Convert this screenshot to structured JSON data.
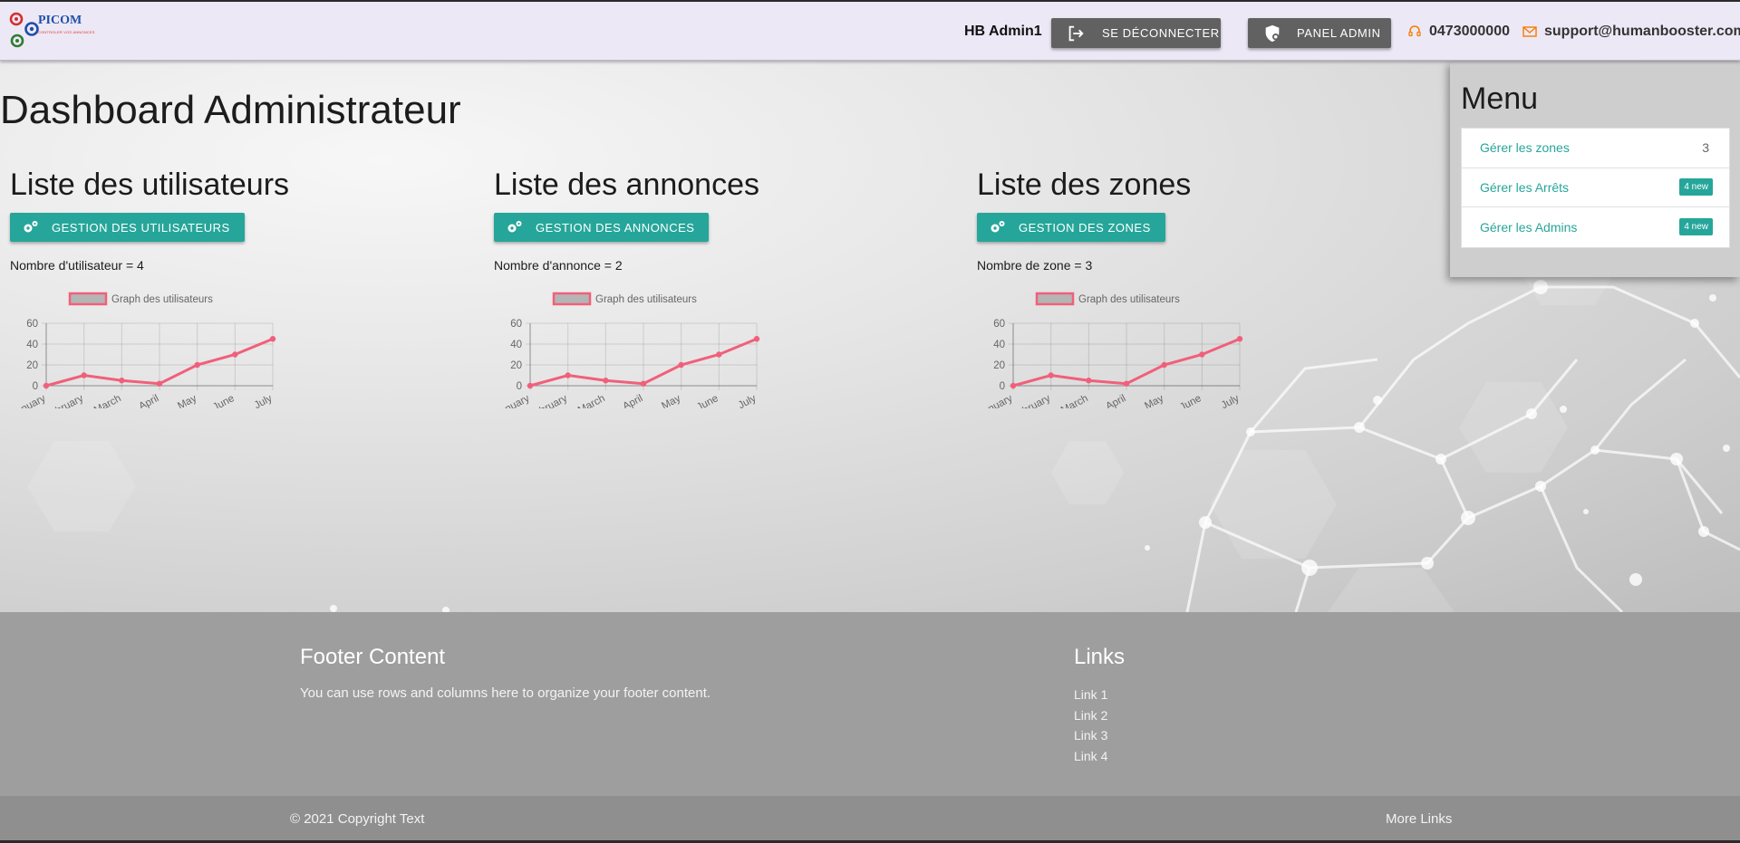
{
  "header": {
    "logo_text": "PICOM",
    "logo_subtext": "CONTROLER VOS ANNONCES",
    "user_name": "HB Admin1",
    "logout_label": "Se déconnecter",
    "panel_label": "Panel Admin",
    "phone": "0473000000",
    "email": "support@humanbooster.com",
    "colors": {
      "bar": "#ede8f5",
      "button": "#616161",
      "contact_icon": "#f57c00"
    }
  },
  "main": {
    "page_title": "Dashboard Administrateur",
    "columns": [
      {
        "title": "Liste des utilisateurs",
        "button_label": "Gestion des utilisateurs",
        "count_text": "Nombre d'utilisateur = 4"
      },
      {
        "title": "Liste des annonces",
        "button_label": "Gestion des annonces",
        "count_text": "Nombre d'annonce = 2"
      },
      {
        "title": "Liste des zones",
        "button_label": "Gestion des zones",
        "count_text": "Nombre de zone = 3"
      }
    ],
    "accent": "#26a69a"
  },
  "chart_data": [
    {
      "type": "line",
      "x": [
        "January",
        "February",
        "March",
        "April",
        "May",
        "June",
        "July"
      ],
      "series": [
        {
          "name": "Graph des utilisateurs",
          "values": [
            0,
            10,
            5,
            2,
            20,
            30,
            45
          ],
          "color": "#f0607a"
        }
      ],
      "yticks": [
        0,
        20,
        40,
        60
      ],
      "ylim": [
        0,
        60
      ],
      "grid": true,
      "legend": "top"
    },
    {
      "type": "line",
      "x": [
        "January",
        "February",
        "March",
        "April",
        "May",
        "June",
        "July"
      ],
      "series": [
        {
          "name": "Graph des utilisateurs",
          "values": [
            0,
            10,
            5,
            2,
            20,
            30,
            45
          ],
          "color": "#f0607a"
        }
      ],
      "yticks": [
        0,
        20,
        40,
        60
      ],
      "ylim": [
        0,
        60
      ],
      "grid": true,
      "legend": "top"
    },
    {
      "type": "line",
      "x": [
        "January",
        "February",
        "March",
        "April",
        "May",
        "June",
        "July"
      ],
      "series": [
        {
          "name": "Graph des utilisateurs",
          "values": [
            0,
            10,
            5,
            2,
            20,
            30,
            45
          ],
          "color": "#f0607a"
        }
      ],
      "yticks": [
        0,
        20,
        40,
        60
      ],
      "ylim": [
        0,
        60
      ],
      "grid": true,
      "legend": "top"
    }
  ],
  "menu": {
    "title": "Menu",
    "items": [
      {
        "label": "Gérer les zones",
        "badge": "3",
        "badge_style": "plain"
      },
      {
        "label": "Gérer les Arrêts",
        "badge": "4 new",
        "badge_style": "new"
      },
      {
        "label": "Gérer les Admins",
        "badge": "4 new",
        "badge_style": "new"
      }
    ]
  },
  "footer": {
    "content_title": "Footer Content",
    "content_text": "You can use rows and columns here to organize your footer content.",
    "links_title": "Links",
    "links": [
      "Link 1",
      "Link 2",
      "Link 3",
      "Link 4"
    ],
    "copyright": "© 2021 Copyright Text",
    "more_links": "More Links"
  }
}
